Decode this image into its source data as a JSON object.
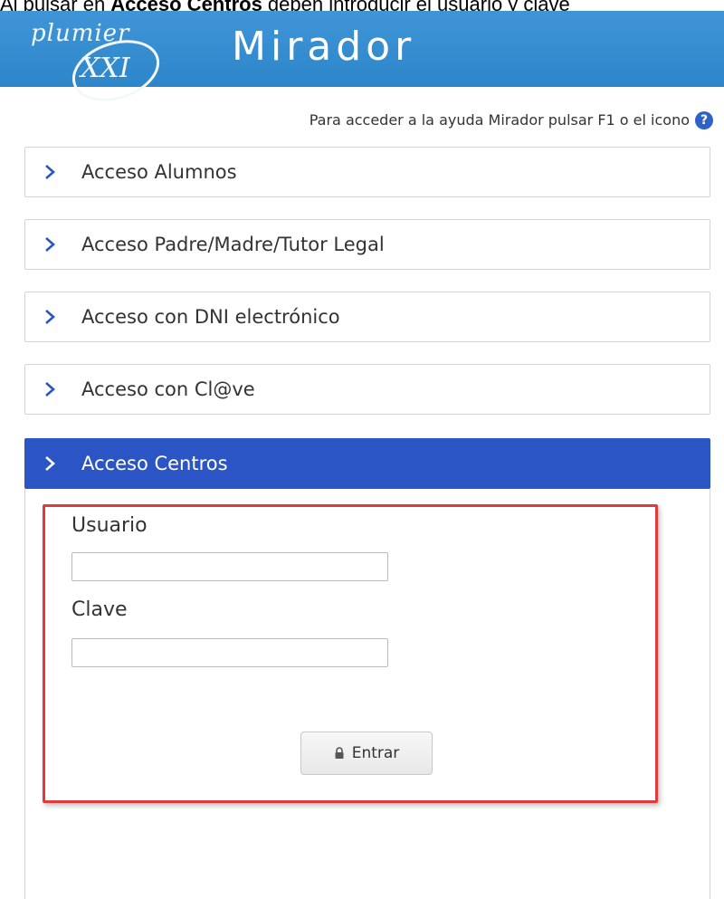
{
  "caption": {
    "prefix": "Al pulsar en ",
    "bold": "Acceso Centros",
    "suffix": " deben introducir el usuario y clave"
  },
  "header": {
    "logo_text": "plumier",
    "logo_suffix": "XXI",
    "app_title": "Mirador",
    "background_color": "#3f95d6"
  },
  "help": {
    "text": "Para acceder a la ayuda Mirador pulsar F1 o el icono",
    "icon": "question-circle-icon"
  },
  "accordion": {
    "items": [
      {
        "label": "Acceso Alumnos"
      },
      {
        "label": "Acceso Padre/Madre/Tutor Legal"
      },
      {
        "label": "Acceso con DNI electrónico"
      },
      {
        "label": "Acceso con Cl@ve"
      },
      {
        "label": "Acceso Centros",
        "active": true
      }
    ],
    "chevron_icon": "chevron-right-icon",
    "active_color": "#2b55c5"
  },
  "login_form": {
    "user_label": "Usuario",
    "user_value": "",
    "password_label": "Clave",
    "password_value": "",
    "submit_label": "Entrar",
    "submit_icon": "lock-icon",
    "highlight_color": "#e2393b"
  }
}
